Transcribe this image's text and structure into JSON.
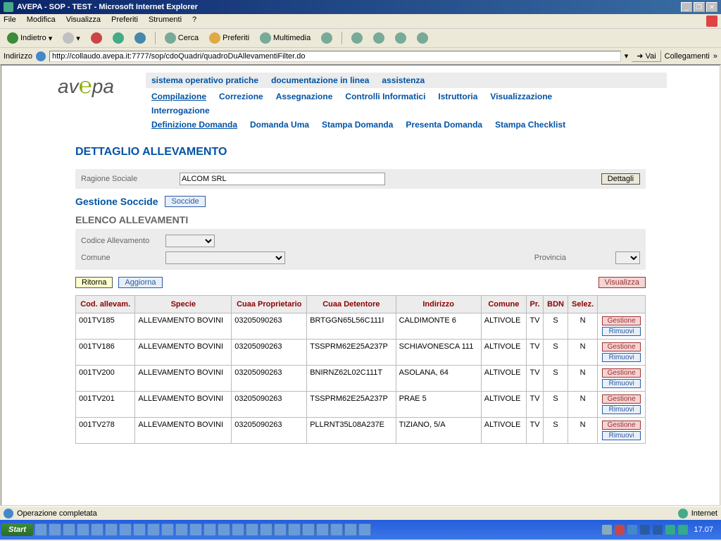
{
  "window": {
    "title": "AVEPA - SOP - TEST - Microsoft Internet Explorer"
  },
  "menubar": {
    "file": "File",
    "modifica": "Modifica",
    "visualizza": "Visualizza",
    "preferiti": "Preferiti",
    "strumenti": "Strumenti",
    "help": "?"
  },
  "toolbar": {
    "indietro": "Indietro",
    "cerca": "Cerca",
    "preferiti": "Preferiti",
    "multimedia": "Multimedia"
  },
  "addressbar": {
    "label": "Indirizzo",
    "url": "http://collaudo.avepa.it:7777/sop/cdoQuadri/quadroDuAllevamentiFilter.do",
    "vai": "Vai",
    "collegamenti": "Collegamenti"
  },
  "topnav": {
    "n1": "sistema operativo pratiche",
    "n2": "documentazione in linea",
    "n3": "assistenza"
  },
  "mainnav": {
    "r1": {
      "a": "Compilazione",
      "b": "Correzione",
      "c": "Assegnazione",
      "d": "Controlli Informatici",
      "e": "Istruttoria",
      "f": "Visualizzazione"
    },
    "r2": {
      "a": "Interrogazione"
    },
    "r3": {
      "a": "Definizione Domanda",
      "b": "Domanda Uma",
      "c": "Stampa Domanda",
      "d": "Presenta Domanda",
      "e": "Stampa Checklist"
    }
  },
  "page": {
    "title": "DETTAGLIO ALLEVAMENTO",
    "ragione_label": "Ragione Sociale",
    "ragione_value": "ALCOM SRL",
    "dettagli_btn": "Dettagli",
    "gestione_title": "Gestione Soccide",
    "soccide_btn": "Soccide",
    "elenco_title": "ELENCO ALLEVAMENTI",
    "filter_codice": "Codice Allevamento",
    "filter_comune": "Comune",
    "filter_provincia": "Provincia",
    "btn_ritorna": "Ritorna",
    "btn_aggiorna": "Aggiorna",
    "btn_visualizza": "Visualizza",
    "btn_gestione": "Gestione",
    "btn_rimuovi": "Rimuovi"
  },
  "table": {
    "headers": {
      "h1": "Cod. allevam.",
      "h2": "Specie",
      "h3": "Cuaa Proprietario",
      "h4": "Cuaa Detentore",
      "h5": "Indirizzo",
      "h6": "Comune",
      "h7": "Pr.",
      "h8": "BDN",
      "h9": "Selez."
    },
    "rows": [
      {
        "c1": "001TV185",
        "c2": "ALLEVAMENTO BOVINI",
        "c3": "03205090263",
        "c4": "BRTGGN65L56C111I",
        "c5": "CALDIMONTE 6",
        "c6": "ALTIVOLE",
        "c7": "TV",
        "c8": "S",
        "c9": "N"
      },
      {
        "c1": "001TV186",
        "c2": "ALLEVAMENTO BOVINI",
        "c3": "03205090263",
        "c4": "TSSPRM62E25A237P",
        "c5": "SCHIAVONESCA 111",
        "c6": "ALTIVOLE",
        "c7": "TV",
        "c8": "S",
        "c9": "N"
      },
      {
        "c1": "001TV200",
        "c2": "ALLEVAMENTO BOVINI",
        "c3": "03205090263",
        "c4": "BNIRNZ62L02C111T",
        "c5": "ASOLANA, 64",
        "c6": "ALTIVOLE",
        "c7": "TV",
        "c8": "S",
        "c9": "N"
      },
      {
        "c1": "001TV201",
        "c2": "ALLEVAMENTO BOVINI",
        "c3": "03205090263",
        "c4": "TSSPRM62E25A237P",
        "c5": "PRAE 5",
        "c6": "ALTIVOLE",
        "c7": "TV",
        "c8": "S",
        "c9": "N"
      },
      {
        "c1": "001TV278",
        "c2": "ALLEVAMENTO BOVINI",
        "c3": "03205090263",
        "c4": "PLLRNT35L08A237E",
        "c5": "TIZIANO, 5/A",
        "c6": "ALTIVOLE",
        "c7": "TV",
        "c8": "S",
        "c9": "N"
      }
    ]
  },
  "statusbar": {
    "left": "Operazione completata",
    "right": "Internet"
  },
  "taskbar": {
    "start": "Start",
    "clock": "17.07"
  }
}
